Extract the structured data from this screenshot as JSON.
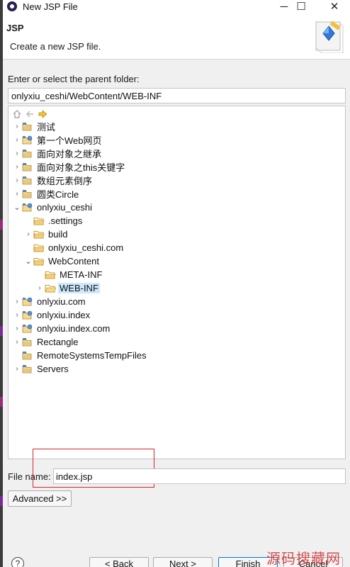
{
  "window": {
    "title": "New JSP File",
    "minimize_glyph": "─",
    "maximize_glyph": "☐",
    "close_glyph": "✕"
  },
  "header": {
    "title": "JSP",
    "description": "Create a new JSP file."
  },
  "parent_folder": {
    "label": "Enter or select the parent folder:",
    "value": "onlyxiu_ceshi/WebContent/WEB-INF"
  },
  "tree": {
    "toolbar": [
      "home-icon",
      "back-icon",
      "forward-icon"
    ],
    "items": [
      {
        "label": "测试",
        "depth": 0,
        "expander": "collapsed",
        "icon": "project-icon",
        "selected": false
      },
      {
        "label": "第一个Web网页",
        "depth": 0,
        "expander": "collapsed",
        "icon": "web-project-icon",
        "selected": false
      },
      {
        "label": "面向对象之继承",
        "depth": 0,
        "expander": "collapsed",
        "icon": "project-icon",
        "selected": false
      },
      {
        "label": "面向对象之this关键字",
        "depth": 0,
        "expander": "collapsed",
        "icon": "project-icon",
        "selected": false
      },
      {
        "label": "数组元素倒序",
        "depth": 0,
        "expander": "collapsed",
        "icon": "project-icon",
        "selected": false
      },
      {
        "label": "圆类Circle",
        "depth": 0,
        "expander": "collapsed",
        "icon": "project-icon",
        "selected": false
      },
      {
        "label": "onlyxiu_ceshi",
        "depth": 0,
        "expander": "expanded",
        "icon": "web-project-icon",
        "selected": false
      },
      {
        "label": ".settings",
        "depth": 1,
        "expander": "none",
        "icon": "folder-icon",
        "selected": false
      },
      {
        "label": "build",
        "depth": 1,
        "expander": "collapsed",
        "icon": "folder-icon",
        "selected": false
      },
      {
        "label": "onlyxiu_ceshi.com",
        "depth": 1,
        "expander": "none",
        "icon": "folder-icon",
        "selected": false
      },
      {
        "label": "WebContent",
        "depth": 1,
        "expander": "expanded",
        "icon": "folder-icon",
        "selected": false
      },
      {
        "label": "META-INF",
        "depth": 2,
        "expander": "none",
        "icon": "folder-icon",
        "selected": false
      },
      {
        "label": "WEB-INF",
        "depth": 2,
        "expander": "collapsed",
        "icon": "folder-open-icon",
        "selected": true
      },
      {
        "label": "onlyxiu.com",
        "depth": 0,
        "expander": "collapsed",
        "icon": "web-project-icon",
        "selected": false
      },
      {
        "label": "onlyxiu.index",
        "depth": 0,
        "expander": "collapsed",
        "icon": "web-project-icon",
        "selected": false
      },
      {
        "label": "onlyxiu.index.com",
        "depth": 0,
        "expander": "collapsed",
        "icon": "web-project-icon",
        "selected": false
      },
      {
        "label": "Rectangle",
        "depth": 0,
        "expander": "collapsed",
        "icon": "project-icon",
        "selected": false
      },
      {
        "label": "RemoteSystemsTempFiles",
        "depth": 0,
        "expander": "none",
        "icon": "project-icon",
        "selected": false
      },
      {
        "label": "Servers",
        "depth": 0,
        "expander": "collapsed",
        "icon": "project-icon",
        "selected": false
      }
    ]
  },
  "file_name": {
    "label": "File name:",
    "value": "index.jsp"
  },
  "advanced_button": "Advanced >>",
  "help_glyph": "?",
  "buttons": {
    "back": "< Back",
    "next": "Next >",
    "finish": "Finish",
    "cancel": "Cancel"
  },
  "watermark": "源码搜藏网",
  "colors": {
    "selection": "#cce8ff",
    "annotation_box": "#d9252e",
    "folder": "#e8b64c",
    "default_button_border": "#0078d7"
  }
}
